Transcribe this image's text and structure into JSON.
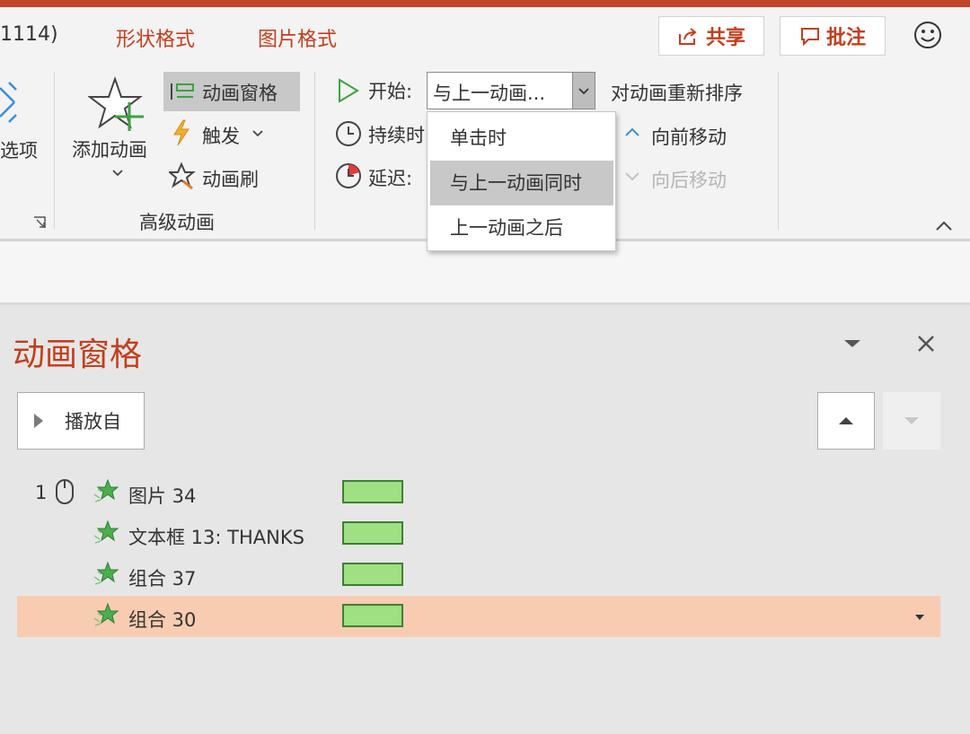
{
  "tabs": {
    "truncated_title": "1114)",
    "shape_format": "形状格式",
    "picture_format": "图片格式"
  },
  "header_buttons": {
    "share": "共享",
    "comments": "批注"
  },
  "ribbon": {
    "effect_options_partial": "选项",
    "add_animation": "添加动画",
    "animation_pane": "动画窗格",
    "trigger": "触发",
    "animation_painter": "动画刷",
    "group_advanced": "高级动画",
    "start_label": "开始:",
    "start_value": "与上一动画...",
    "duration_label": "持续时",
    "delay_label": "延迟:",
    "reorder_title": "对动画重新排序",
    "move_earlier": "向前移动",
    "move_later": "向后移动"
  },
  "start_dropdown": {
    "options": [
      "单击时",
      "与上一动画同时",
      "上一动画之后"
    ],
    "highlighted": "与上一动画同时"
  },
  "pane": {
    "title": "动画窗格",
    "play_from": "播放自",
    "items": [
      {
        "index": "1",
        "name": "图片 34"
      },
      {
        "index": "",
        "name": "文本框 13: THANKS"
      },
      {
        "index": "",
        "name": "组合 37"
      },
      {
        "index": "",
        "name": "组合 30"
      }
    ],
    "selected_item": "组合 30"
  },
  "colors": {
    "accent": "#c43e1c",
    "selected_row": "#f8ccb1",
    "timeline_bar": "#9ee082",
    "timeline_bar_border": "#3f7f34"
  }
}
